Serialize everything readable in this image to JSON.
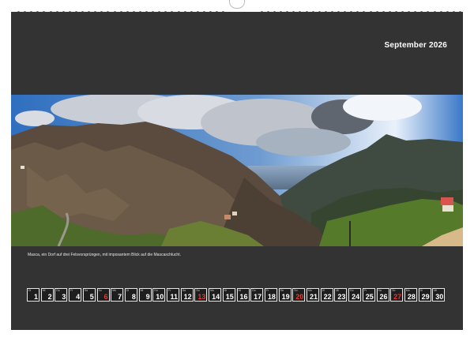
{
  "calendar": {
    "month_title": "September 2026",
    "caption": "Masca, ein Dorf auf drei Felsvorsprüngen, mit imposantem Blick auf die Mascaschlucht.",
    "days": [
      {
        "wd": "Di",
        "d": "1"
      },
      {
        "wd": "Mi",
        "d": "2"
      },
      {
        "wd": "Do",
        "d": "3"
      },
      {
        "wd": "Fr",
        "d": "4"
      },
      {
        "wd": "Sa",
        "d": "5"
      },
      {
        "wd": "So",
        "d": "6",
        "red": true
      },
      {
        "wd": "Mo",
        "d": "7"
      },
      {
        "wd": "Di",
        "d": "8"
      },
      {
        "wd": "Mi",
        "d": "9"
      },
      {
        "wd": "Do",
        "d": "10"
      },
      {
        "wd": "Fr",
        "d": "11"
      },
      {
        "wd": "Sa",
        "d": "12"
      },
      {
        "wd": "So",
        "d": "13",
        "red": true
      },
      {
        "wd": "Mo",
        "d": "14"
      },
      {
        "wd": "Di",
        "d": "15"
      },
      {
        "wd": "Mi",
        "d": "16"
      },
      {
        "wd": "Do",
        "d": "17"
      },
      {
        "wd": "Fr",
        "d": "18"
      },
      {
        "wd": "Sa",
        "d": "19"
      },
      {
        "wd": "So",
        "d": "20",
        "red": true
      },
      {
        "wd": "Mo",
        "d": "21"
      },
      {
        "wd": "Di",
        "d": "22"
      },
      {
        "wd": "Mi",
        "d": "23"
      },
      {
        "wd": "Do",
        "d": "24"
      },
      {
        "wd": "Fr",
        "d": "25"
      },
      {
        "wd": "Sa",
        "d": "26"
      },
      {
        "wd": "So",
        "d": "27",
        "red": true
      },
      {
        "wd": "Mo",
        "d": "28"
      },
      {
        "wd": "Di",
        "d": "29"
      },
      {
        "wd": "Mi",
        "d": "30"
      }
    ]
  },
  "colors": {
    "sheet": "#333333",
    "sunday": "#e53935"
  }
}
